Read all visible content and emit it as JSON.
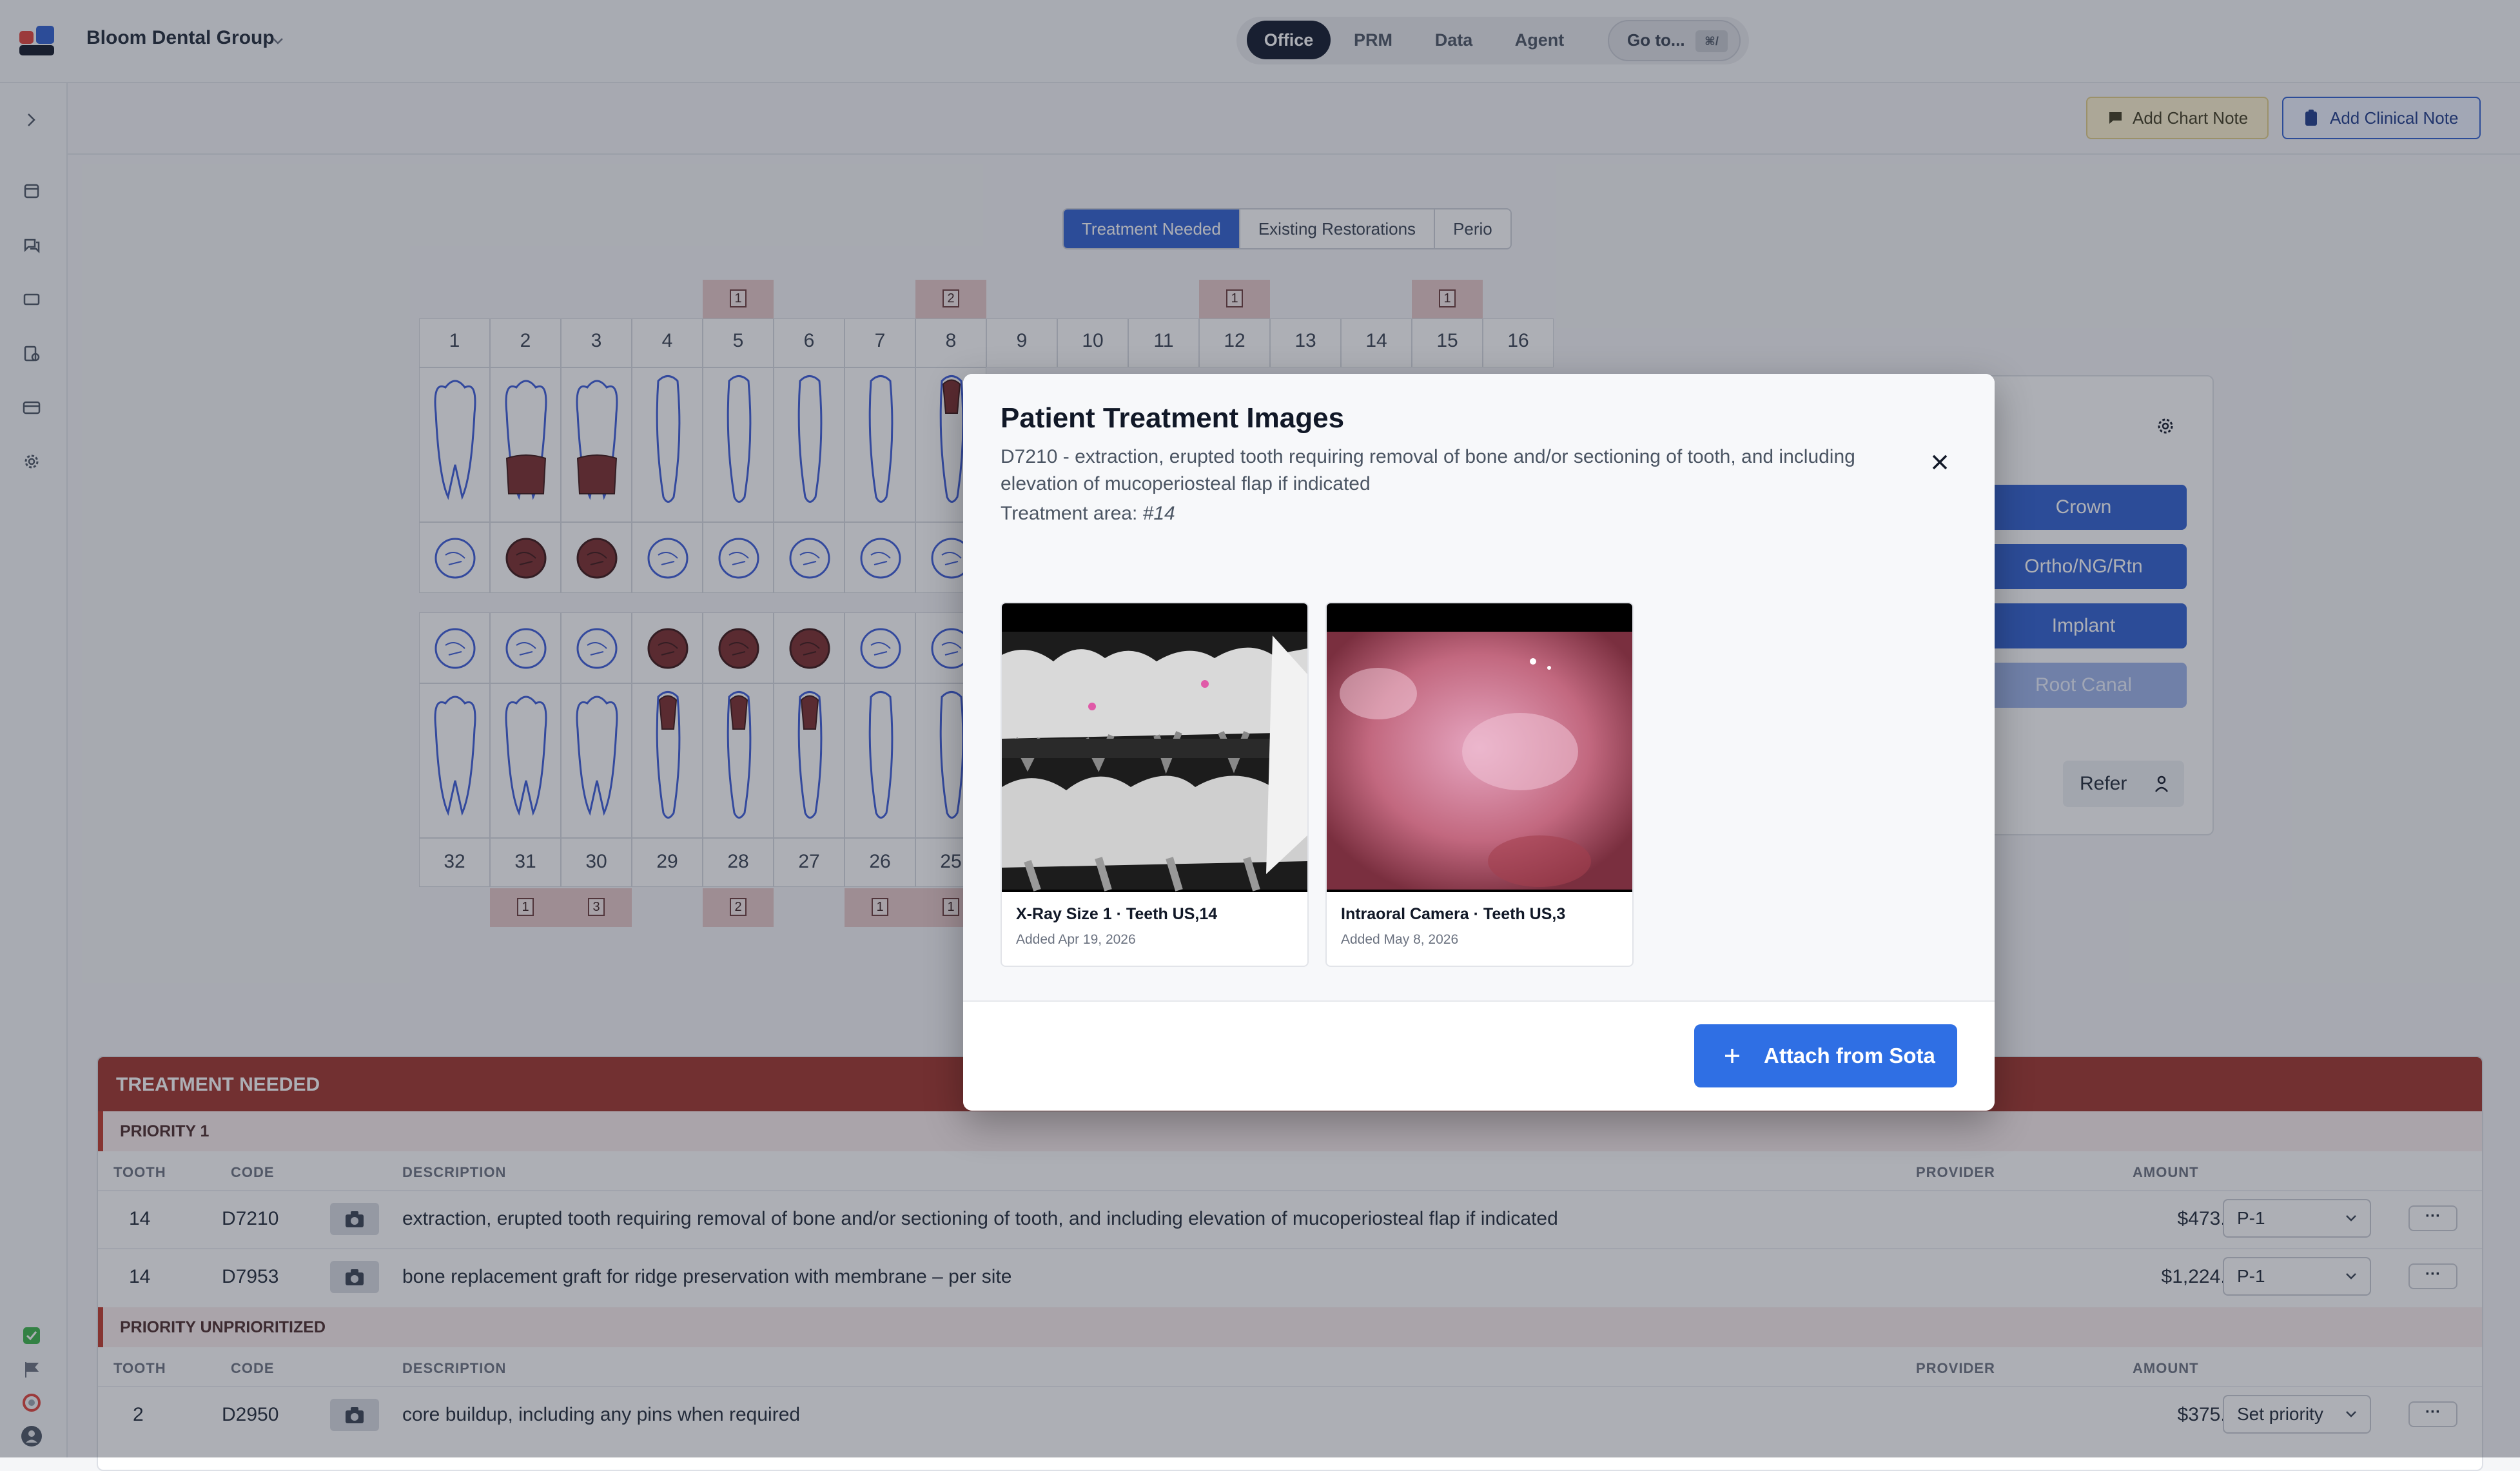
{
  "header": {
    "org_name": "Bloom Dental Group",
    "nav": [
      "Office",
      "PRM",
      "Data",
      "Agent"
    ],
    "active_nav": "Office",
    "goto_label": "Go to...",
    "goto_shortcut": "⌘/"
  },
  "sidebar": {
    "icons": [
      "expand-icon",
      "calendar-icon",
      "chat-icon",
      "ticket-icon",
      "clipboard-icon",
      "card-icon",
      "settings-icon"
    ],
    "bottom_icons": [
      "check-icon",
      "flag-icon",
      "help-icon",
      "user-icon"
    ]
  },
  "actions": {
    "chart_note": "Add Chart Note",
    "clinical_note": "Add Clinical Note"
  },
  "chart_tabs": {
    "tabs": [
      "Treatment Needed",
      "Existing Restorations",
      "Perio"
    ],
    "active": "Treatment Needed"
  },
  "tooth_chart": {
    "upper_numbers": [
      "1",
      "2",
      "3",
      "4",
      "5",
      "6",
      "7",
      "8",
      "9",
      "10",
      "11",
      "12",
      "13",
      "14",
      "15",
      "16"
    ],
    "lower_numbers": [
      "32",
      "31",
      "30",
      "29",
      "28",
      "27",
      "26",
      "25"
    ],
    "upper_badges": [
      {
        "tooth": "5",
        "count": "1"
      },
      {
        "tooth": "8",
        "count": "2"
      },
      {
        "tooth": "12",
        "count": "1"
      },
      {
        "tooth": "15",
        "count": "1"
      }
    ],
    "lower_badges": [
      {
        "tooth": "31",
        "count": "1"
      },
      {
        "tooth": "30",
        "count": "3"
      },
      {
        "tooth": "28",
        "count": "2"
      },
      {
        "tooth": "26",
        "count": "1"
      },
      {
        "tooth": "25",
        "count": "1"
      }
    ],
    "treated_color": "#7a2a2a",
    "outline_color": "#3a5bd9"
  },
  "side_panel": {
    "buttons": [
      "Crown",
      "Ortho/NG/Rtn",
      "Implant",
      "Root Canal"
    ],
    "refer_label": "Refer"
  },
  "treatment_table": {
    "title": "TREATMENT NEEDED",
    "columns": [
      "TOOTH",
      "CODE",
      "DESCRIPTION",
      "PROVIDER",
      "AMOUNT"
    ],
    "groups": [
      {
        "label": "PRIORITY 1",
        "rows": [
          {
            "tooth": "14",
            "code": "D7210",
            "description": "extraction, erupted tooth requiring removal of bone and/or sectioning of tooth, and including elevation of mucoperiosteal flap if indicated",
            "amount": "$473.00",
            "priority": "P-1"
          },
          {
            "tooth": "14",
            "code": "D7953",
            "description": "bone replacement graft for ridge preservation with membrane – per site",
            "amount": "$1,224.00",
            "priority": "P-1"
          }
        ]
      },
      {
        "label": "PRIORITY UNPRIORITIZED",
        "rows": [
          {
            "tooth": "2",
            "code": "D2950",
            "description": "core buildup, including any pins when required",
            "amount": "$375.00",
            "priority": "Set priority"
          }
        ]
      }
    ]
  },
  "modal": {
    "title": "Patient Treatment Images",
    "description": "D7210 - extraction, erupted tooth requiring removal of bone and/or sectioning of tooth, and including elevation of mucoperiosteal flap if indicated",
    "area_label": "Treatment area:",
    "area_value": "#14",
    "images": [
      {
        "caption": "X-Ray Size 1 · Teeth US,14",
        "date": "Added Apr 19, 2026"
      },
      {
        "caption": "Intraoral Camera · Teeth US,3",
        "date": "Added May 8, 2026"
      }
    ],
    "attach_label": "Attach from Sota"
  }
}
